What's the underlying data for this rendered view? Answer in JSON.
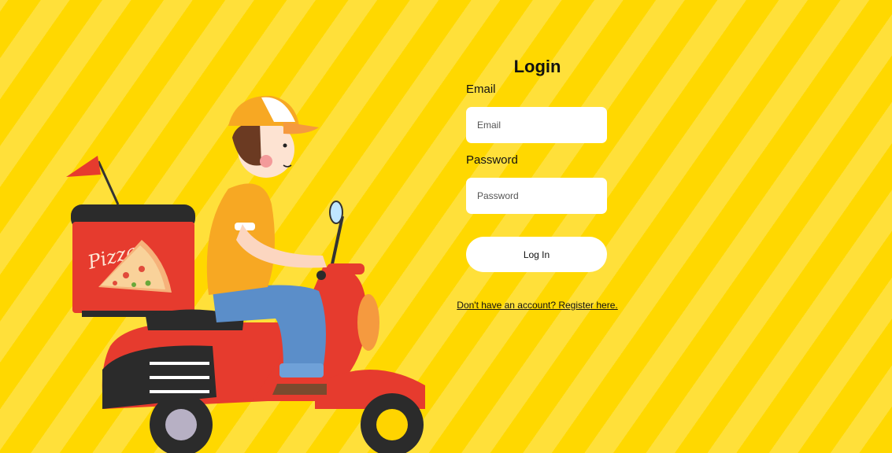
{
  "login": {
    "title": "Login",
    "email_label": "Email",
    "email_placeholder": "Email",
    "email_value": "",
    "password_label": "Password",
    "password_placeholder": "Password",
    "password_value": "",
    "submit_label": "Log In",
    "register_link": "Don't have an account? Register here."
  },
  "illustration": {
    "box_text": "Pizza",
    "icon": "pizza-delivery-scooter-illustration"
  },
  "colors": {
    "background": "#ffd800",
    "stripe": "#ffe03a",
    "scooter_red": "#e63b2e",
    "shirt_orange": "#f7a823",
    "jeans_blue": "#5b8ec9"
  }
}
